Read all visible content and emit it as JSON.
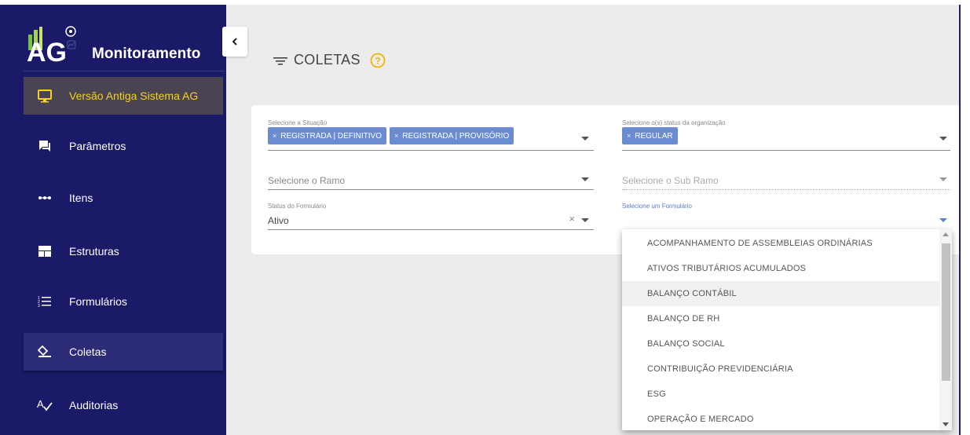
{
  "app": {
    "logo_text": "AG",
    "title": "Monitoramento"
  },
  "sidebar": {
    "items": [
      {
        "label": "Versão Antiga Sistema AG",
        "icon": "monitor-icon"
      },
      {
        "label": "Parâmetros",
        "icon": "chat-icon"
      },
      {
        "label": "Itens",
        "icon": "dots-icon"
      },
      {
        "label": "Estruturas",
        "icon": "layout-icon"
      },
      {
        "label": "Formulários",
        "icon": "list-icon"
      },
      {
        "label": "Coletas",
        "icon": "collect-icon"
      },
      {
        "label": "Auditorias",
        "icon": "spellcheck-icon"
      }
    ]
  },
  "header": {
    "title": "COLETAS"
  },
  "filters": {
    "situacao": {
      "label": "Selecione a Situação",
      "chips": [
        "REGISTRADA | DEFINITIVO",
        "REGISTRADA | PROVISÓRIO"
      ]
    },
    "status_org": {
      "label": "Selecione o(s) status da organização",
      "chips": [
        "REGULAR"
      ]
    },
    "ramo": {
      "placeholder": "Selecione o Ramo"
    },
    "sub_ramo": {
      "placeholder": "Selecione o Sub Ramo"
    },
    "status_form": {
      "label": "Status do Formulário",
      "value": "Ativo"
    },
    "formulario": {
      "label": "Selecione um Formulário"
    }
  },
  "dropdown": {
    "options": [
      "ACOMPANHAMENTO DE ASSEMBLEIAS ORDINÁRIAS",
      "ATIVOS TRIBUTÁRIOS ACUMULADOS",
      "BALANÇO CONTÁBIL",
      "BALANÇO DE RH",
      "BALANÇO SOCIAL",
      "CONTRIBUIÇÃO PREVIDENCIÁRIA",
      "ESG",
      "OPERAÇÃO E MERCADO"
    ],
    "hovered_index": 2
  },
  "colors": {
    "sidebar_bg": "#1a1a68",
    "old_version_text": "#f5d21f",
    "chip_bg": "#6c8cd1",
    "help_icon": "#f0b400"
  }
}
